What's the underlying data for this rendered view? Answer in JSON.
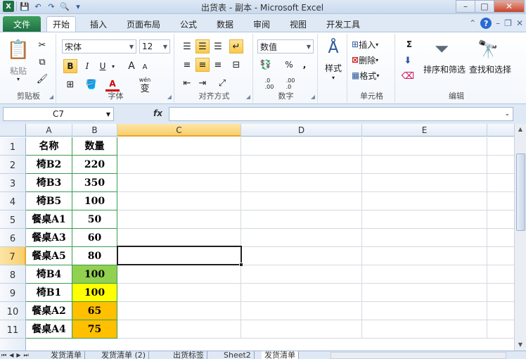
{
  "window": {
    "title": "出货表 - 副本 - Microsoft Excel"
  },
  "tabs": [
    {
      "label": "文件"
    },
    {
      "label": "开始"
    },
    {
      "label": "插入"
    },
    {
      "label": "页面布局"
    },
    {
      "label": "公式"
    },
    {
      "label": "数据"
    },
    {
      "label": "审阅"
    },
    {
      "label": "视图"
    },
    {
      "label": "开发工具"
    }
  ],
  "ribbon": {
    "clipboard": {
      "label": "剪贴板",
      "paste": "粘贴"
    },
    "font": {
      "label": "字体",
      "name": "宋体",
      "size": "12",
      "bold": "B",
      "italic": "I",
      "underline": "U",
      "grow": "A",
      "shrink": "A",
      "color_letter": "A",
      "wen": "wén",
      "wen_char": "变"
    },
    "align": {
      "label": "对齐方式"
    },
    "number": {
      "label": "数字",
      "format": "数值",
      "percent": "%",
      "comma": ",",
      "inc": ".0\n.00",
      "dec": ".00\n.0"
    },
    "style": {
      "label": "样式"
    },
    "cells": {
      "label": "单元格",
      "insert": "插入",
      "delete": "删除",
      "format": "格式"
    },
    "editing": {
      "label": "编辑",
      "sum": "Σ",
      "sort": "排序和筛选",
      "find": "查找和选择"
    }
  },
  "formula_bar": {
    "name_box": "C7",
    "fx": "fx",
    "value": ""
  },
  "columns": [
    "A",
    "B",
    "C",
    "D",
    "E"
  ],
  "rows": [
    {
      "n": "1",
      "a": "名称",
      "b": "数量",
      "fill": ""
    },
    {
      "n": "2",
      "a": "椅B2",
      "b": "220",
      "fill": ""
    },
    {
      "n": "3",
      "a": "椅B3",
      "b": "350",
      "fill": ""
    },
    {
      "n": "4",
      "a": "椅B5",
      "b": "100",
      "fill": ""
    },
    {
      "n": "5",
      "a": "餐桌A1",
      "b": "50",
      "fill": ""
    },
    {
      "n": "6",
      "a": "餐桌A3",
      "b": "60",
      "fill": ""
    },
    {
      "n": "7",
      "a": "餐桌A5",
      "b": "80",
      "fill": ""
    },
    {
      "n": "8",
      "a": "椅B4",
      "b": "100",
      "fill": "#92d050"
    },
    {
      "n": "9",
      "a": "椅B1",
      "b": "100",
      "fill": "#ffff00"
    },
    {
      "n": "10",
      "a": "餐桌A2",
      "b": "65",
      "fill": "#ffc000"
    },
    {
      "n": "11",
      "a": "餐桌A4",
      "b": "75",
      "fill": "#ffc000"
    }
  ],
  "selected_cell": "C7",
  "sheets": [
    {
      "label": "发货清单",
      "active": false
    },
    {
      "label": "发货清单 (2)",
      "active": false
    },
    {
      "label": "出货标签",
      "active": false
    },
    {
      "label": "Sheet2",
      "active": false
    },
    {
      "label": "发货清单",
      "active": true
    }
  ],
  "colors": {
    "file_tab": "#1e7145",
    "accent_select": "#f9cf6a",
    "data_border": "#3a9c52"
  }
}
